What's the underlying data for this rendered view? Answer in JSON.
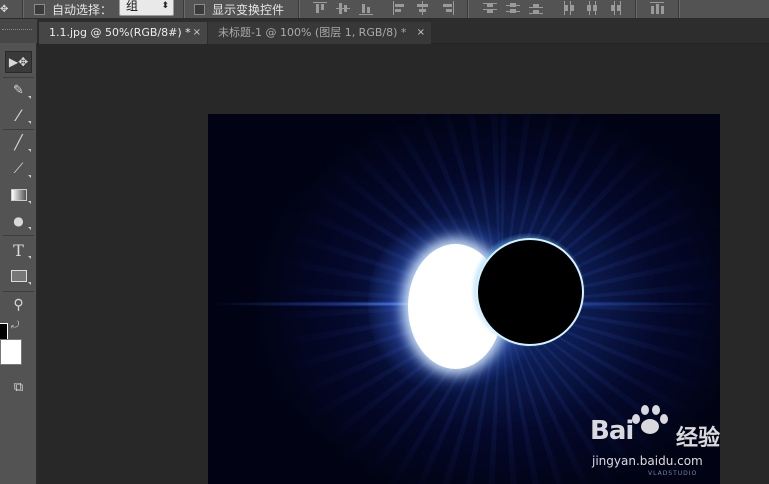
{
  "options_bar": {
    "move_icon": "move-arrows-icon",
    "auto_select_label": "自动选择：",
    "auto_select_checked": false,
    "auto_select_target": "组",
    "show_transform_label": "显示变换控件",
    "show_transform_checked": false
  },
  "tabs": [
    {
      "label": "1.1.jpg @ 50%(RGB/8#) *",
      "active": true,
      "close": "×"
    },
    {
      "label": "未标题-1 @ 100% (图层 1, RGB/8) *",
      "active": false,
      "close": "×"
    }
  ],
  "tools": [
    {
      "name": "move-tool",
      "icon": "move-icon",
      "glyph": "▶✥"
    },
    {
      "name": "quick-selection-tool",
      "icon": "quick-selection-icon",
      "glyph": "✎"
    },
    {
      "name": "eyedropper-tool",
      "icon": "eyedropper-icon",
      "glyph": "⁄"
    },
    {
      "name": "brush-tool",
      "icon": "brush-icon",
      "glyph": "╱"
    },
    {
      "name": "history-brush-tool",
      "icon": "history-brush-icon",
      "glyph": "⟋"
    },
    {
      "name": "gradient-tool",
      "icon": "gradient-icon",
      "glyph": "▭"
    },
    {
      "name": "dodge-tool",
      "icon": "dodge-icon",
      "glyph": "●"
    },
    {
      "name": "type-tool",
      "icon": "type-icon",
      "glyph": "T"
    },
    {
      "name": "rectangle-tool",
      "icon": "rectangle-icon",
      "glyph": "▭"
    },
    {
      "name": "zoom-tool",
      "icon": "zoom-icon",
      "glyph": "⚲"
    },
    {
      "name": "screen-mode",
      "icon": "screen-mode-icon",
      "glyph": "⧉"
    }
  ],
  "colors": {
    "foreground": "#000000",
    "background": "#ffffff"
  },
  "canvas": {
    "credit": "VLADSTUDIO"
  },
  "watermark": {
    "brand_latin": "Bai",
    "brand_cn": "经验",
    "site": "jingyan.baidu.com"
  }
}
